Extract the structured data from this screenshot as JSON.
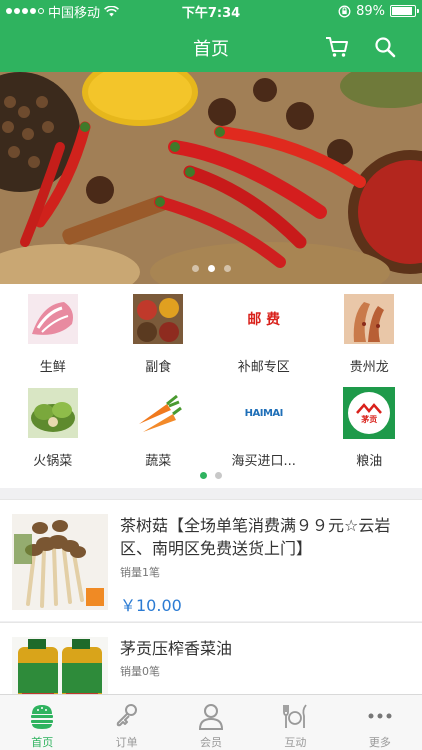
{
  "status_bar": {
    "carrier": "中国移动",
    "time": "下午7:34",
    "battery": "89%",
    "battery_level": 0.89
  },
  "header": {
    "title": "首页",
    "cart_icon": "cart-icon",
    "search_icon": "search-icon"
  },
  "banner": {
    "slide_count": 3,
    "active_slide": 1
  },
  "categories": {
    "items": [
      {
        "label": "生鲜",
        "icon": "fresh-meat-image"
      },
      {
        "label": "副食",
        "icon": "spices-image"
      },
      {
        "label": "补邮专区",
        "icon": "postage-image",
        "image_text": "邮 费"
      },
      {
        "label": "贵州龙",
        "icon": "guizhoulong-image"
      },
      {
        "label": "火锅菜",
        "icon": "hotpot-vegetables-image"
      },
      {
        "label": "蔬菜",
        "icon": "carrots-image"
      },
      {
        "label": "海买进口...",
        "icon": "haimai-logo",
        "image_text": "HAIMAI"
      },
      {
        "label": "粮油",
        "icon": "grain-oil-logo",
        "image_text": "茅贡"
      }
    ],
    "page_count": 2,
    "active_page": 0
  },
  "products": [
    {
      "title": "茶树菇【全场单笔消费满９９元☆云岩区、南明区免费送货上门】",
      "sales": "销量1笔",
      "price": "￥10.00"
    },
    {
      "title": "茅贡压榨香菜油",
      "sales": "销量0笔"
    }
  ],
  "tab_bar": {
    "items": [
      {
        "label": "首页",
        "icon": "home-icon",
        "active": true
      },
      {
        "label": "订单",
        "icon": "order-icon",
        "active": false
      },
      {
        "label": "会员",
        "icon": "member-icon",
        "active": false
      },
      {
        "label": "互动",
        "icon": "interaction-icon",
        "active": false
      },
      {
        "label": "更多",
        "icon": "more-icon",
        "active": false
      }
    ]
  },
  "colors": {
    "primary": "#2fb35f",
    "price": "#2b7bd3",
    "text": "#333333",
    "muted": "#999999"
  }
}
